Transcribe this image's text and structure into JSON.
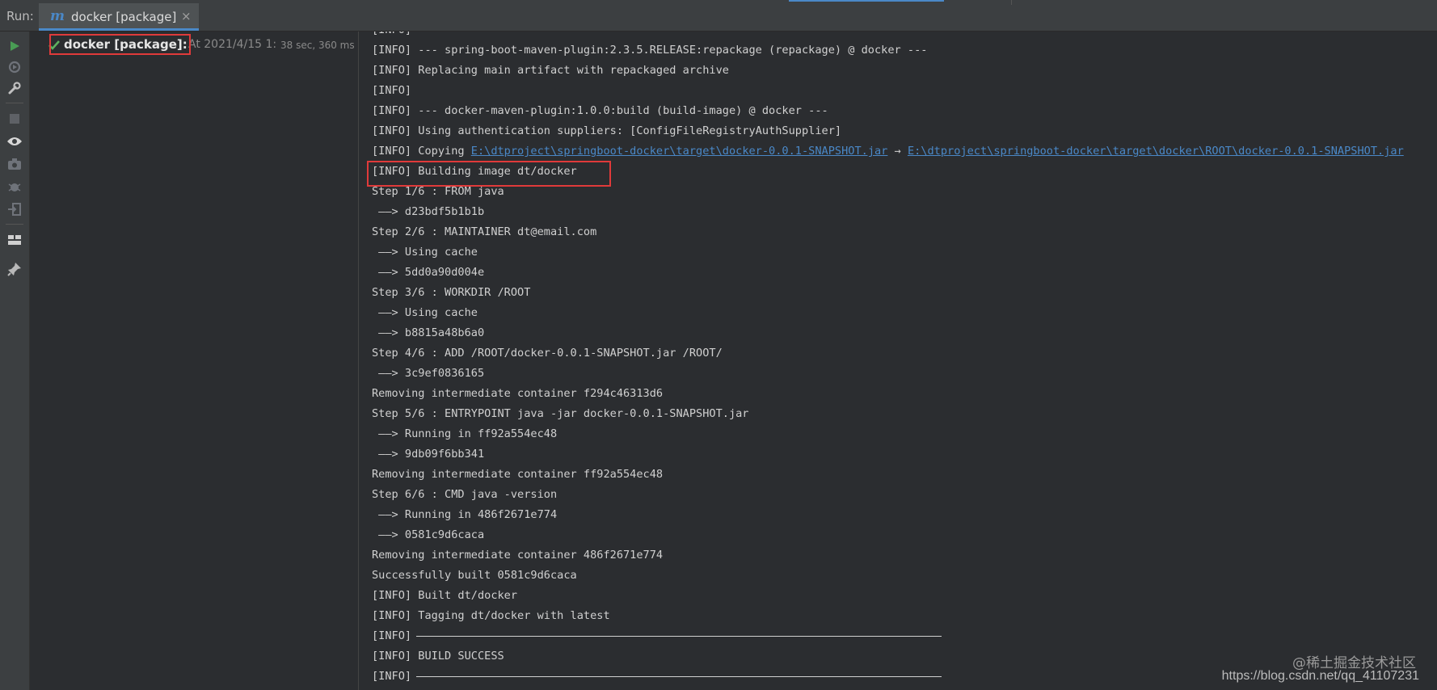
{
  "header": {
    "run_label": "Run:",
    "tab_icon": "m",
    "tab_label": "docker [package]",
    "tab_close": "×"
  },
  "toolbar": {
    "icons": [
      "run-icon",
      "rerun-icon",
      "wrench-icon",
      "stop-icon",
      "eye-icon",
      "camera-icon",
      "debug-icon",
      "login-icon",
      "layout-icon",
      "pin-icon"
    ]
  },
  "tree": {
    "name": "docker [package]:",
    "time": "At 2021/4/15 1:",
    "duration": "38 sec, 360 ms"
  },
  "console": {
    "lines": [
      {
        "text": "[INFO]"
      },
      {
        "text": "[INFO] --- spring-boot-maven-plugin:2.3.5.RELEASE:repackage (repackage) @ docker ---"
      },
      {
        "text": "[INFO] Replacing main artifact with repackaged archive"
      },
      {
        "text": "[INFO]"
      },
      {
        "text": "[INFO] --- docker-maven-plugin:1.0.0:build (build-image) @ docker ---"
      },
      {
        "text": "[INFO] Using authentication suppliers: [ConfigFileRegistryAuthSupplier]"
      },
      {
        "text": "[INFO] Copying ",
        "link1": "E:\\dtproject\\springboot-docker\\target\\docker-0.0.1-SNAPSHOT.jar",
        "arrow": " → ",
        "link2": "E:\\dtproject\\springboot-docker\\target\\docker\\ROOT\\docker-0.0.1-SNAPSHOT.jar"
      },
      {
        "text": "[INFO] Building image dt/docker"
      },
      {
        "text": "Step 1/6 : FROM java"
      },
      {
        "text": " ——> d23bdf5b1b1b"
      },
      {
        "text": "Step 2/6 : MAINTAINER dt@email.com"
      },
      {
        "text": " ——> Using cache"
      },
      {
        "text": " ——> 5dd0a90d004e"
      },
      {
        "text": "Step 3/6 : WORKDIR /ROOT"
      },
      {
        "text": " ——> Using cache"
      },
      {
        "text": " ——> b8815a48b6a0"
      },
      {
        "text": "Step 4/6 : ADD /ROOT/docker-0.0.1-SNAPSHOT.jar /ROOT/"
      },
      {
        "text": " ——> 3c9ef0836165"
      },
      {
        "text": "Removing intermediate container f294c46313d6"
      },
      {
        "text": "Step 5/6 : ENTRYPOINT java -jar docker-0.0.1-SNAPSHOT.jar"
      },
      {
        "text": " ——> Running in ff92a554ec48"
      },
      {
        "text": " ——> 9db09f6bb341"
      },
      {
        "text": "Removing intermediate container ff92a554ec48"
      },
      {
        "text": "Step 6/6 : CMD java -version"
      },
      {
        "text": " ——> Running in 486f2671e774"
      },
      {
        "text": " ——> 0581c9d6caca"
      },
      {
        "text": "Removing intermediate container 486f2671e774"
      },
      {
        "text": "Successfully built 0581c9d6caca"
      },
      {
        "text": "[INFO] Built dt/docker"
      },
      {
        "text": "[INFO] Tagging dt/docker with latest"
      },
      {
        "text": "[INFO]",
        "rule": true
      },
      {
        "text": "[INFO] BUILD SUCCESS"
      },
      {
        "text": "[INFO]",
        "rule": true
      }
    ]
  },
  "watermark": {
    "line1": "@稀土掘金技术社区",
    "line2": "https://blog.csdn.net/qq_41107231"
  },
  "colors": {
    "accent": "#4a88c7",
    "highlight": "#e03a3a",
    "success": "#5fb15f"
  }
}
